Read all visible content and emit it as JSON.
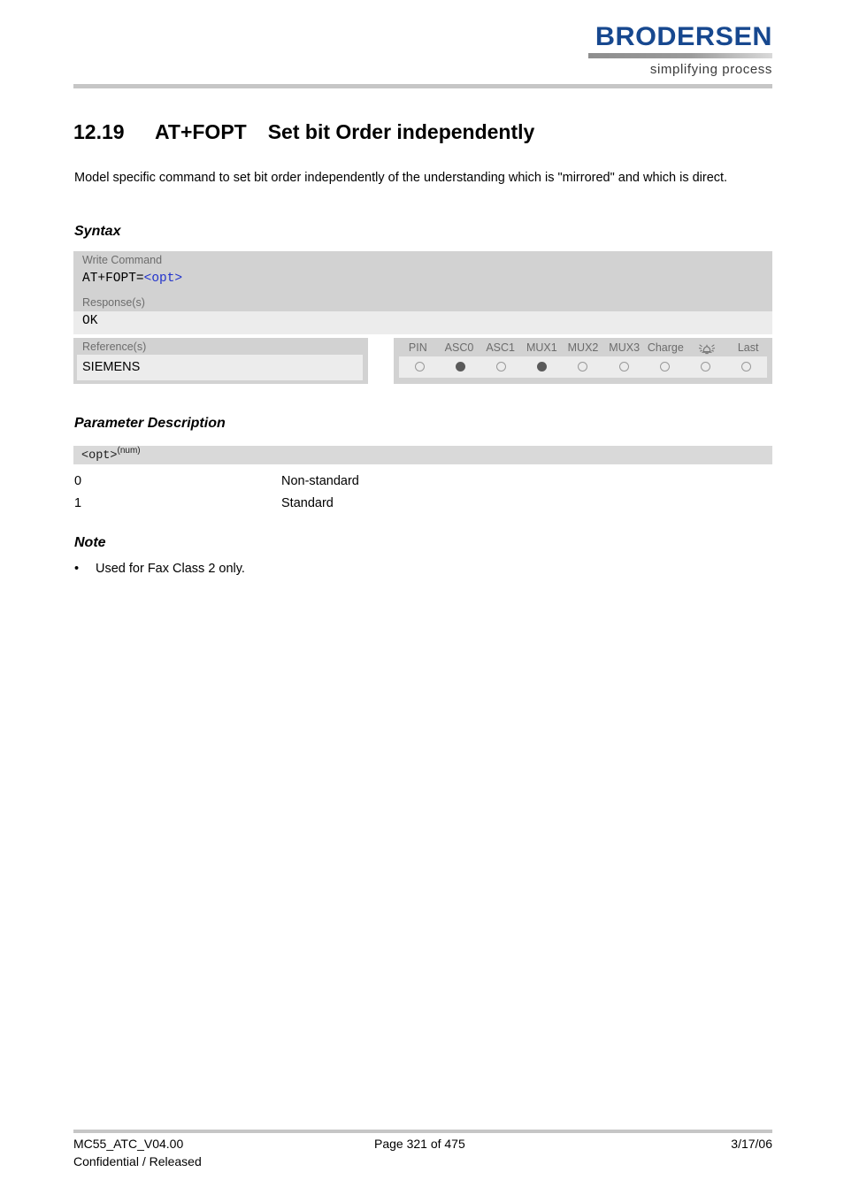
{
  "header": {
    "logo_wordmark": "BRODERSEN",
    "logo_tagline": "simplifying process",
    "logo_color": "#17488f"
  },
  "title": {
    "number": "12.19",
    "command": "AT+FOPT",
    "text": "Set bit Order independently"
  },
  "intro": "Model specific command to set bit order independently of the understanding which is \"mirrored\" and which is direct.",
  "sections": {
    "syntax_heading": "Syntax",
    "parameter_heading": "Parameter Description",
    "note_heading": "Note"
  },
  "syntax": {
    "write_label": "Write Command",
    "write_command_prefix": "AT+FOPT=",
    "write_command_param": "<opt>",
    "response_label": "Response(s)",
    "response_value": "OK",
    "reference_label": "Reference(s)",
    "reference_value": "SIEMENS"
  },
  "capabilities": {
    "columns": [
      {
        "label": "PIN",
        "icon": "",
        "enabled": false
      },
      {
        "label": "ASC0",
        "icon": "",
        "enabled": true
      },
      {
        "label": "ASC1",
        "icon": "",
        "enabled": false
      },
      {
        "label": "MUX1",
        "icon": "",
        "enabled": true
      },
      {
        "label": "MUX2",
        "icon": "",
        "enabled": false
      },
      {
        "label": "MUX3",
        "icon": "",
        "enabled": false
      },
      {
        "label": "Charge",
        "icon": "",
        "enabled": false
      },
      {
        "label": "",
        "icon": "alarm-icon",
        "enabled": false
      },
      {
        "label": "Last",
        "icon": "",
        "enabled": false
      }
    ]
  },
  "parameter": {
    "name": "<opt>",
    "type_sup": "(num)",
    "rows": [
      {
        "key": "0",
        "desc": "Non-standard"
      },
      {
        "key": "1",
        "desc": "Standard"
      }
    ]
  },
  "note": {
    "bullet": "•",
    "items": [
      "Used for Fax Class 2 only."
    ]
  },
  "footer": {
    "doc_id": "MC55_ATC_V04.00",
    "classification": "Confidential / Released",
    "page": "Page 321 of 475",
    "date": "3/17/06"
  }
}
